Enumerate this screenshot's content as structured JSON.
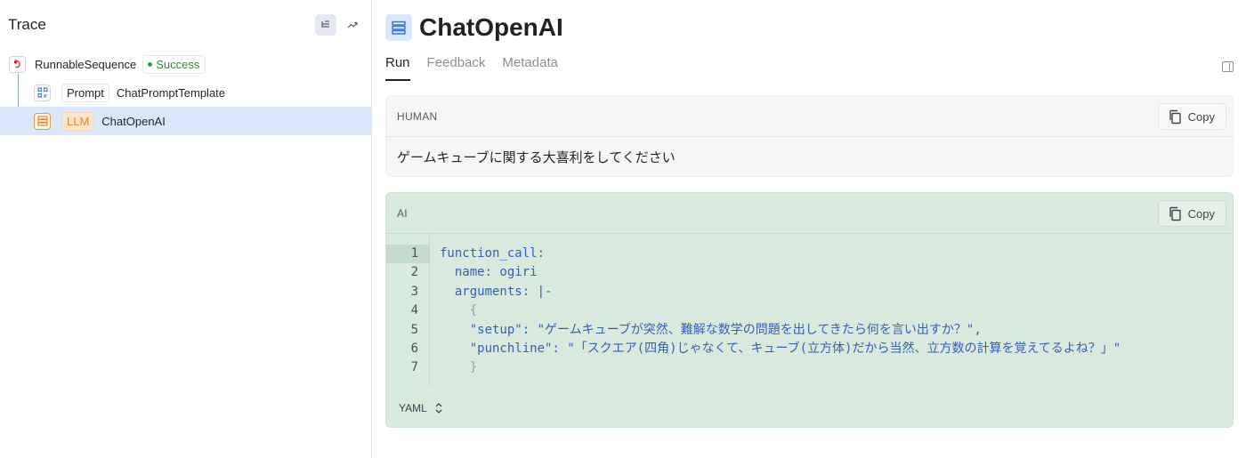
{
  "sidebar": {
    "title": "Trace",
    "tree": [
      {
        "name": "RunnableSequence",
        "status": "Success"
      },
      {
        "type": "Prompt",
        "name": "ChatPromptTemplate"
      },
      {
        "type": "LLM",
        "name": "ChatOpenAI"
      }
    ]
  },
  "main": {
    "title": "ChatOpenAI",
    "tabs": [
      "Run",
      "Feedback",
      "Metadata"
    ],
    "human": {
      "role": "HUMAN",
      "copy_label": "Copy",
      "text": "ゲームキューブに関する大喜利をしてください"
    },
    "ai": {
      "role": "AI",
      "copy_label": "Copy",
      "line_numbers": [
        "1",
        "2",
        "3",
        "4",
        "5",
        "6",
        "7"
      ],
      "code_lines": [
        "function_call:",
        "  name: ogiri",
        "  arguments: |-",
        "    {",
        "    \"setup\": \"ゲームキューブが突然、難解な数学の問題を出してきたら何を言い出すか？\",",
        "    \"punchline\": \"「スクエア(四角)じゃなくて、キューブ(立方体)だから当然、立方数の計算を覚えてるよね？」\"",
        "    }"
      ],
      "format": "YAML"
    }
  },
  "colors": {
    "selected_row": "#dbe8fb",
    "success": "#2e8a3d",
    "llm_accent": "#e8862f",
    "ai_background": "#d9ebde",
    "code_text": "#3560b8"
  }
}
